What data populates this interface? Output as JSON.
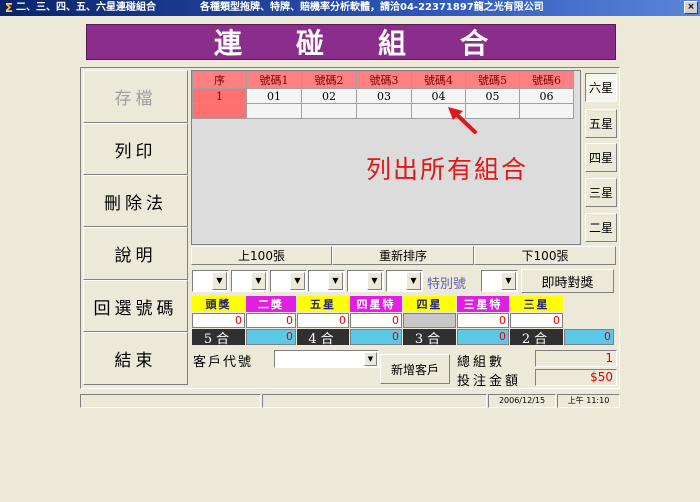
{
  "window": {
    "title": "二、三、四、五、六星連碰組合",
    "subtitle": "各種類型拖牌、特牌、賠機率分析軟體，請洽04-22371897龍之光有限公司",
    "close_label": "×"
  },
  "banner": {
    "chars": [
      "連",
      "碰",
      "組",
      "合"
    ]
  },
  "left_buttons": [
    {
      "label": "存檔",
      "enabled": false
    },
    {
      "label": "列印",
      "enabled": true
    },
    {
      "label": "刪除法",
      "enabled": true
    },
    {
      "label": "說明",
      "enabled": true
    },
    {
      "label": "回選號碼",
      "enabled": true
    },
    {
      "label": "結束",
      "enabled": true
    }
  ],
  "grid": {
    "headers": [
      "序",
      "號碼1",
      "號碼2",
      "號碼3",
      "號碼4",
      "號碼5",
      "號碼6"
    ],
    "rows": [
      [
        "1",
        "01",
        "02",
        "03",
        "04",
        "05",
        "06"
      ]
    ]
  },
  "annotation": "列出所有組合",
  "star_buttons": [
    "六星",
    "五星",
    "四星",
    "三星",
    "二星"
  ],
  "active_star": "六星",
  "page_buttons": {
    "prev": "上100張",
    "reorder": "重新排序",
    "next": "下100張"
  },
  "special_label": "特別號",
  "instant_button": "即時對獎",
  "prizes": {
    "labels": [
      "頭獎",
      "二獎",
      "五星",
      "四星特",
      "四星",
      "三星特",
      "三星"
    ],
    "values": [
      "0",
      "0",
      "0",
      "0",
      "",
      "0",
      "0"
    ],
    "hits": [
      "5合",
      "4合",
      "3合",
      "2合"
    ],
    "hit_values": [
      "0",
      "0",
      "0",
      "0"
    ]
  },
  "customer": {
    "label": "客戶代號",
    "new_button": "新增客戶"
  },
  "summary": {
    "count_label": "總組數",
    "count_value": "1",
    "amount_label": "投注金額",
    "amount_value": "$50"
  },
  "statusbar": {
    "date": "2006/12/15",
    "time": "上午 11:10"
  }
}
